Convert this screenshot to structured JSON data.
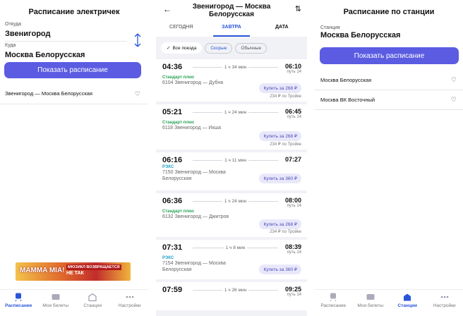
{
  "screen1": {
    "title": "Расписание электричек",
    "from_label": "Откуда",
    "from_value": "Звенигород",
    "to_label": "Куда",
    "to_value": "Москва Белорусская",
    "show_button": "Показать расписание",
    "favorite_route": "Звенигород — Москва Белорусская",
    "ad": {
      "main": "MAMMA MIA!",
      "tag": "МЮЗИКЛ ВОЗВРАЩАЕТСЯ",
      "sub": "НЕ ТАК"
    }
  },
  "screen2": {
    "title": "Звенигород — Москва Белорусская",
    "tabs": [
      "СЕГОДНЯ",
      "ЗАВТРА",
      "ДАТА"
    ],
    "active_tab": "ЗАВТРА",
    "filters": [
      "Все поезда",
      "Скорые",
      "Обычные"
    ],
    "trains": [
      {
        "dep": "04:36",
        "dur": "1 ч 34 мин",
        "arr": "06:10",
        "track": "путь 14",
        "type": "Стандарт плюс",
        "type_color": "green",
        "name": "6104 Звенигород — Дубна",
        "buy": "Купить за 268 ₽",
        "troika": "234 ₽ по Тройке"
      },
      {
        "dep": "05:21",
        "dur": "1 ч 24 мин",
        "arr": "06:45",
        "track": "путь 14",
        "type": "Стандарт плюс",
        "type_color": "green",
        "name": "6118 Звенигород — Икша",
        "buy": "Купить за 268 ₽",
        "troika": "234 ₽ по Тройке"
      },
      {
        "dep": "06:16",
        "dur": "1 ч 11 мин",
        "arr": "07:27",
        "track": "",
        "type": "РЭКС",
        "type_color": "cyan",
        "name": "7150 Звенигород — Москва Белорусская",
        "buy": "Купить за 360 ₽",
        "troika": ""
      },
      {
        "dep": "06:36",
        "dur": "1 ч 24 мин",
        "arr": "08:00",
        "track": "путь 14",
        "type": "Стандарт плюс",
        "type_color": "green",
        "name": "6132 Звенигород — Дмитров",
        "buy": "Купить за 268 ₽",
        "troika": "234 ₽ по Тройке"
      },
      {
        "dep": "07:31",
        "dur": "1 ч 8 мин",
        "arr": "08:39",
        "track": "путь 14",
        "type": "РЭКС",
        "type_color": "cyan",
        "name": "7154 Звенигород — Москва Белорусская",
        "buy": "Купить за 360 ₽",
        "troika": ""
      },
      {
        "dep": "07:59",
        "dur": "1 ч 26 мин",
        "arr": "09:25",
        "track": "путь 14",
        "type": "",
        "type_color": "green",
        "name": "",
        "buy": "",
        "troika": ""
      }
    ]
  },
  "screen3": {
    "title": "Расписание по станции",
    "station_label": "Станция",
    "station_value": "Москва Белорусская",
    "show_button": "Показать расписание",
    "favorites": [
      "Москва Белорусская",
      "Москва ВК Восточный"
    ]
  },
  "tabbar": [
    "Расписание",
    "Мои билеты",
    "Станции",
    "Настройки"
  ],
  "colors": {
    "accent": "#5b5ce2",
    "link": "#2a55d9",
    "green": "#2aa35a",
    "cyan": "#1e9fc9"
  }
}
